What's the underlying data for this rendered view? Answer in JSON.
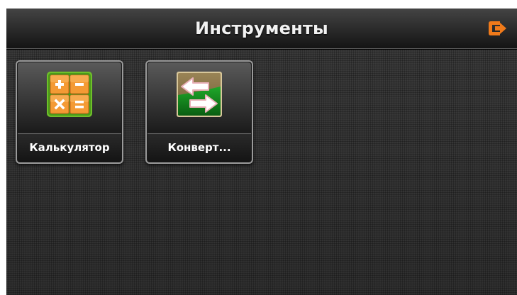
{
  "header": {
    "title": "Инструменты",
    "exit_icon": "exit-icon",
    "accent_color": "#f07a1a"
  },
  "tiles": [
    {
      "label": "Калькулятор",
      "icon": "calculator-icon"
    },
    {
      "label": "Конверт...",
      "icon": "converter-icon"
    }
  ]
}
